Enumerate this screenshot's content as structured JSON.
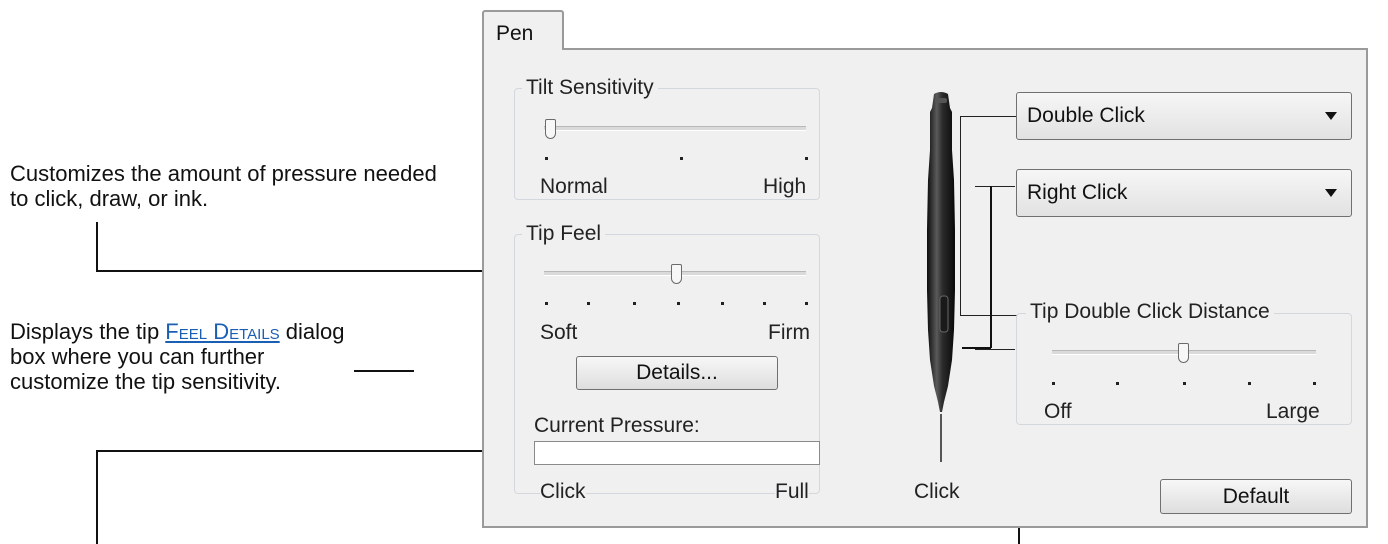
{
  "annotations": {
    "tip_feel": "Customizes the amount of pressure needed to click, draw, or ink.",
    "details_prefix": "Displays the tip ",
    "details_link": "Feel Details",
    "details_suffix": " dialog box where you can further customize the tip sensitivity."
  },
  "tab": {
    "label": "Pen"
  },
  "tilt": {
    "title": "Tilt Sensitivity",
    "min_label": "Normal",
    "max_label": "High",
    "level": 0.0
  },
  "tip_feel": {
    "title": "Tip Feel",
    "min_label": "Soft",
    "max_label": "Firm",
    "level": 0.5,
    "details_button": "Details..."
  },
  "pressure": {
    "label": "Current Pressure:",
    "min_label": "Click",
    "max_label": "Full",
    "value": 0
  },
  "pen": {
    "click_label": "Click",
    "upper_button": "Double Click",
    "lower_button": "Right Click"
  },
  "double_click_distance": {
    "title": "Tip Double Click Distance",
    "min_label": "Off",
    "max_label": "Large",
    "level": 0.5
  },
  "default_button": "Default"
}
